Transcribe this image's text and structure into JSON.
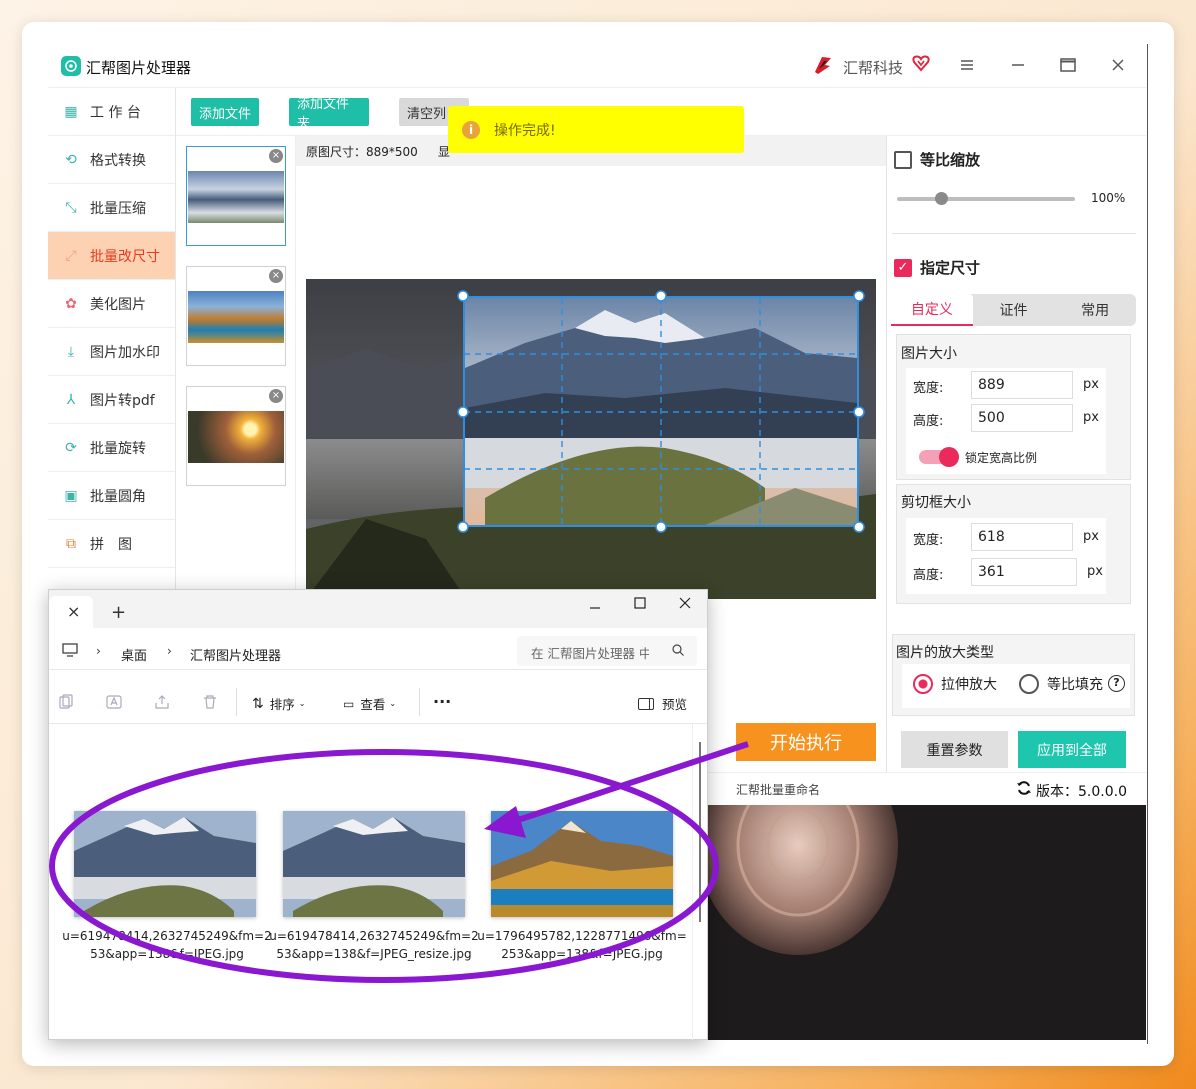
{
  "app": {
    "title": "汇帮图片处理器",
    "brand": "汇帮科技",
    "menu_icon": "menu-icon",
    "minimize_icon": "minimize-icon",
    "maximize_icon": "maximize-icon",
    "close_icon": "close-icon"
  },
  "sidebar": {
    "items": [
      {
        "label": "工 作 台",
        "icon": "grid-icon"
      },
      {
        "label": "格式转换",
        "icon": "convert-icon"
      },
      {
        "label": "批量压缩",
        "icon": "compress-icon"
      },
      {
        "label": "批量改尺寸",
        "icon": "resize-icon",
        "active": true
      },
      {
        "label": "美化图片",
        "icon": "beautify-icon"
      },
      {
        "label": "图片加水印",
        "icon": "watermark-icon"
      },
      {
        "label": "图片转pdf",
        "icon": "pdf-icon"
      },
      {
        "label": "批量旋转",
        "icon": "rotate-icon"
      },
      {
        "label": "批量圆角",
        "icon": "round-corner-icon"
      },
      {
        "label": "拼　图",
        "icon": "collage-icon"
      }
    ]
  },
  "toolbar": {
    "add_file": "添加文件",
    "add_folder": "添加文件夹",
    "clear_list": "清空列"
  },
  "toast": {
    "message": "操作完成!"
  },
  "info_bar": {
    "original_size": "原图尺寸：889*500",
    "partial": "显"
  },
  "right_panel": {
    "proportional_scale": "等比缩放",
    "scale_value": "100%",
    "scale_fraction": 0.25,
    "specify_size": "指定尺寸",
    "tabs": [
      "自定义",
      "证件",
      "常用"
    ],
    "image_size_title": "图片大小",
    "width_label": "宽度:",
    "height_label": "高度:",
    "width_value": "889",
    "height_value": "500",
    "unit": "px",
    "lock_ratio": "锁定宽高比例",
    "crop_title": "剪切框大小",
    "crop_width": "618",
    "crop_height": "361",
    "enlarge_title": "图片的放大类型",
    "stretch": "拉伸放大",
    "fill": "等比填充",
    "help_icon": "help-icon",
    "reset": "重置参数",
    "apply_all": "应用到全部"
  },
  "start_button": "开始执行",
  "footer": {
    "rename_link": "汇帮批量重命名",
    "version": "版本：5.0.0.0",
    "refresh_icon": "refresh-icon"
  },
  "explorer": {
    "tab_close": "×",
    "new_tab": "+",
    "breadcrumb": [
      "桌面",
      "汇帮图片处理器"
    ],
    "search_placeholder": "在 汇帮图片处理器 中搜索",
    "sort": "排序",
    "view": "查看",
    "more": "···",
    "preview": "预览",
    "files": [
      {
        "name": "u=619478414,2632745249&fm=253&app=138&f=JPEG.jpg"
      },
      {
        "name": "u=619478414,2632745249&fm=253&app=138&f=JPEG_resize.jpg"
      },
      {
        "name": "u=1796495782,1228771496&fm=253&app=138&f=JPEG.jpg"
      }
    ]
  },
  "colors": {
    "accent_teal": "#1fbea6",
    "accent_pink": "#ea2a5a",
    "start_orange": "#f7921e",
    "annotation_purple": "#8a18d0",
    "toast_yellow": "#ffff00"
  }
}
